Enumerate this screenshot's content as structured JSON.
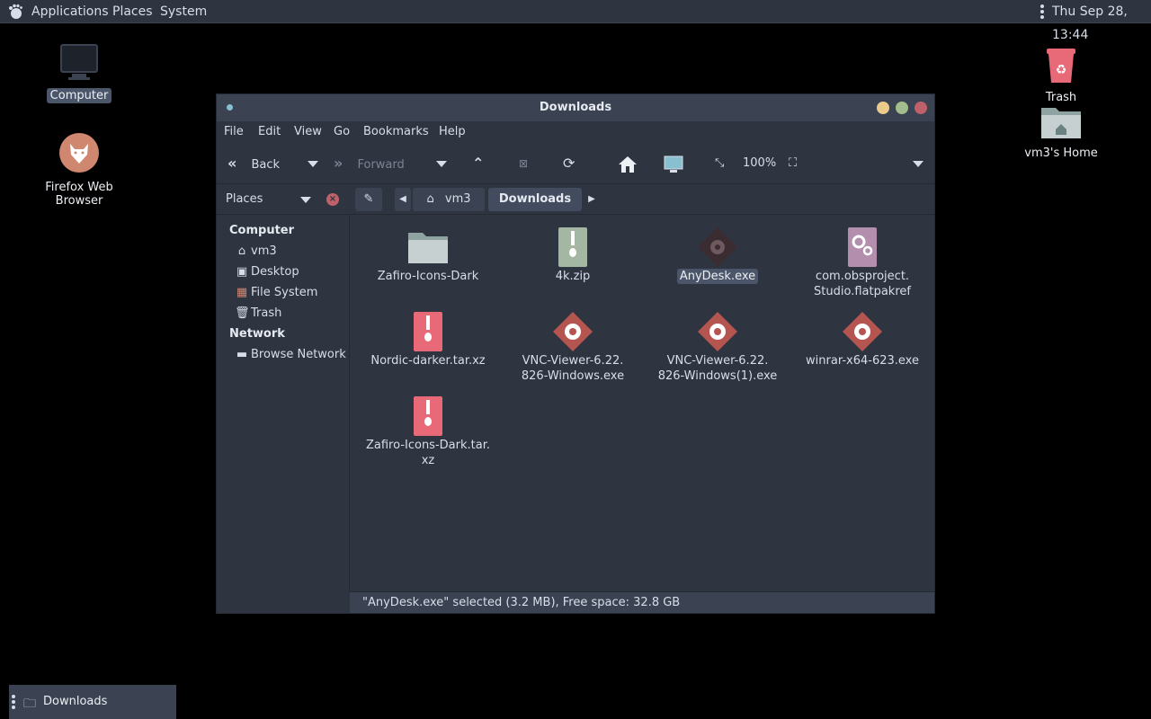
{
  "top_panel": {
    "menus": [
      "Applications",
      "Places",
      "System"
    ],
    "clock": "Thu Sep 28, 13:44"
  },
  "desktop": {
    "icons": [
      {
        "label": "Computer",
        "icon": "monitor-icon",
        "selected": true
      },
      {
        "label": "Firefox Web Browser",
        "icon": "firefox-icon"
      },
      {
        "label": "Trash",
        "icon": "trash-icon"
      },
      {
        "label": "vm3's Home",
        "icon": "home-folder-icon"
      }
    ]
  },
  "window": {
    "title": "Downloads",
    "menus": [
      "File",
      "Edit",
      "View",
      "Go",
      "Bookmarks",
      "Help"
    ],
    "toolbar": {
      "back": "Back",
      "forward": "Forward",
      "zoom": "100%"
    },
    "location": {
      "places_label": "Places",
      "crumbs": [
        "vm3",
        "Downloads"
      ]
    },
    "sidebar": {
      "sections": [
        {
          "title": "Computer",
          "items": [
            {
              "label": "vm3",
              "icon": "home-icon"
            },
            {
              "label": "Desktop",
              "icon": "desktop-icon"
            },
            {
              "label": "File System",
              "icon": "drive-icon"
            },
            {
              "label": "Trash",
              "icon": "trash-icon"
            }
          ]
        },
        {
          "title": "Network",
          "items": [
            {
              "label": "Browse Network",
              "icon": "network-icon"
            }
          ]
        }
      ]
    },
    "files": [
      {
        "name": "Zafiro-Icons-Dark",
        "type": "folder"
      },
      {
        "name": "4k.zip",
        "type": "zip"
      },
      {
        "name": "AnyDesk.exe",
        "type": "exe",
        "selected": true
      },
      {
        "name_lines": [
          "com.obsproject.",
          "Studio.flatpakref"
        ],
        "type": "flatpakref"
      },
      {
        "name": "Nordic-darker.tar.xz",
        "type": "archive"
      },
      {
        "name_lines": [
          "VNC-Viewer-6.22.",
          "826-Windows.exe"
        ],
        "type": "exe"
      },
      {
        "name_lines": [
          "VNC-Viewer-6.22.",
          "826-Windows(1).exe"
        ],
        "type": "exe"
      },
      {
        "name": "winrar-x64-623.exe",
        "type": "exe"
      },
      {
        "name_lines": [
          "Zafiro-Icons-Dark.tar.",
          "xz"
        ],
        "type": "archive"
      }
    ],
    "status": "\"AnyDesk.exe\" selected (3.2 MB), Free space: 32.8 GB"
  },
  "taskbar": {
    "items": [
      {
        "label": "Downloads",
        "icon": "folder-icon"
      }
    ]
  },
  "colors": {
    "accent_close": "#bf616a",
    "accent_min": "#ebcb8b",
    "accent_max": "#a3be8c",
    "exe_icon": "#b5554f",
    "archive_icon": "#e86a78"
  }
}
